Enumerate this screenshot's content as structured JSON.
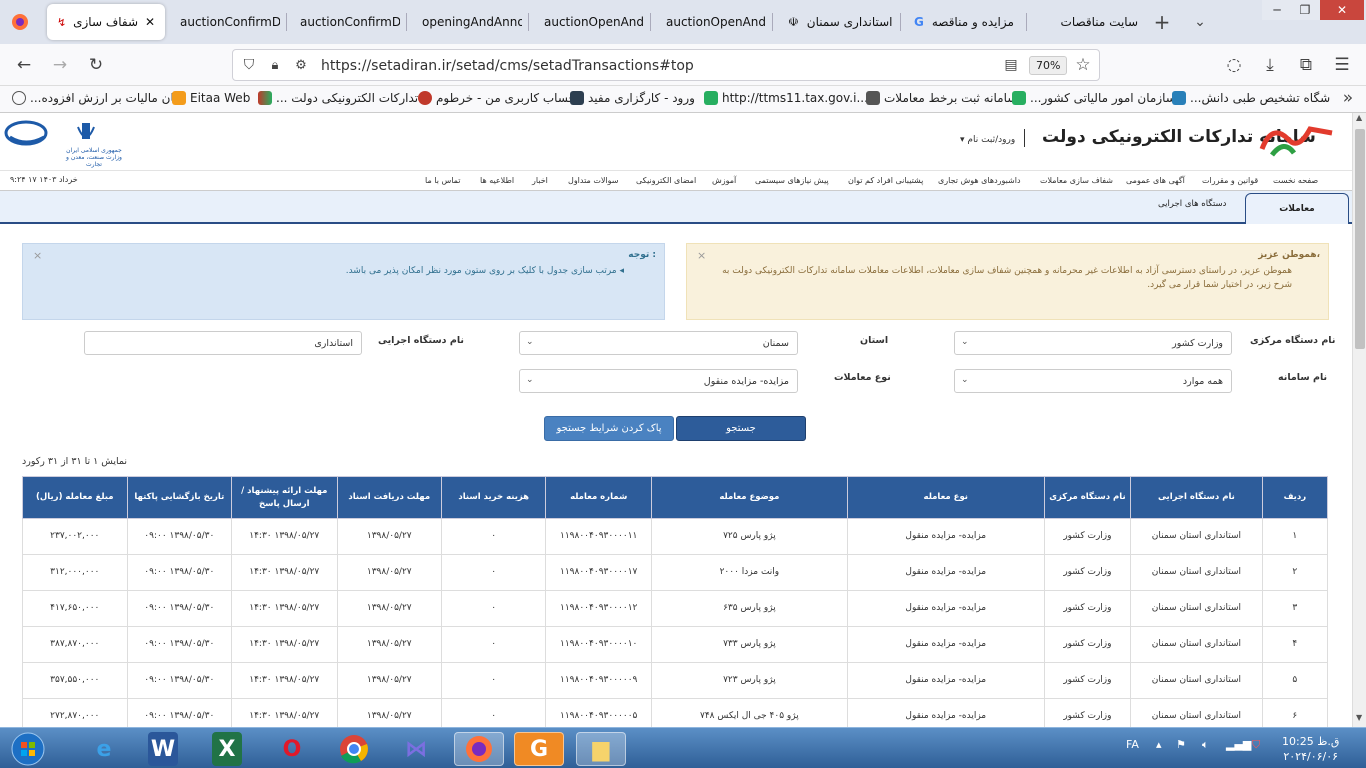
{
  "browser": {
    "tabs": [
      {
        "label": "شفاف سازی",
        "active": true
      },
      {
        "label": "auctionConfirmDis"
      },
      {
        "label": "auctionConfirmDis"
      },
      {
        "label": "openingAndAnnou"
      },
      {
        "label": "auctionOpenAndC"
      },
      {
        "label": "auctionOpenAndC"
      },
      {
        "label": "استانداری سمنان"
      },
      {
        "label": "مزایده و مناقصه"
      },
      {
        "label": "سایت مناقصات"
      }
    ],
    "url": "https://setadiran.ir/setad/cms/setadTransactions#top",
    "zoom": "70%",
    "bookmarks": [
      "...پان مالیات بر ارزش افزوده",
      "Eitaa Web",
      "... تدارکات الکترونیکی دولت",
      "حساب کاربری من - خرطوم",
      "ورود - کارگزاری مفید",
      "http://ttms11.tax.gov.i...",
      "سامانه ثبت برخط معاملات",
      "...سازمان امور مالیاتی کشور",
      "...شگاه تشخیص طبی دانش"
    ]
  },
  "site": {
    "title": "سامانه تدارکات الکترونیکی دولت",
    "login": "ورود/ثبت نام",
    "ministry": "جمهوری اسلامی ایران\nوزارت صنعت، معدن و تجارت",
    "datetime": "۹:۲۴ ۱۷ خرداد ۱۴۰۳",
    "menu": [
      "صفحه نخست",
      "قوانین و مقررات",
      "آگهی های عمومی",
      "شفاف سازی معاملات",
      "داشبوردهای هوش تجاری",
      "پشتیبانی افراد کم توان",
      "پیش نیازهای سیستمی",
      "آموزش",
      "امضای الکترونیکی",
      "سوالات متداول",
      "اخبار",
      "اطلاعیه ها",
      "تماس با ما"
    ],
    "subtabs": {
      "active": "معاملات",
      "other": "دستگاه های اجرایی"
    },
    "notice_right": {
      "title": "هموطن عزیز،",
      "text": "هموطن عزیز، در راستای دسترسی آزاد به اطلاعات غیر محرمانه و همچنین شفاف سازی معاملات، اطلاعات معاملات سامانه تدارکات الکترونیکی دولت به شرح زیر، در اختیار شما قرار می گیرد."
    },
    "notice_left": {
      "title": "توجه :",
      "text": "مرتب سازی جدول با کلیک بر روی ستون مورد نظر امکان پذیر می باشد."
    },
    "filters": {
      "central_label": "نام دستگاه مرکزی",
      "central_value": "وزارت کشور",
      "province_label": "استان",
      "province_value": "سمنان",
      "exec_label": "نام دستگاه اجرایی",
      "exec_value": "استانداری",
      "system_label": "نام سامانه",
      "system_value": "همه موارد",
      "type_label": "نوع معاملات",
      "type_value": "مزایده- مزایده منقول"
    },
    "buttons": {
      "search": "جستجو",
      "clear": "پاک کردن شرایط جستجو"
    },
    "records": "نمایش ۱ تا ۳۱ از ۳۱ رکورد",
    "table": {
      "headers": [
        "ردیف",
        "نام دستگاه اجرایی",
        "نام دستگاه مرکزی",
        "نوع معامله",
        "موضوع معامله",
        "شماره معامله",
        "هزینه خرید اسناد",
        "مهلت دریافت اسناد",
        "مهلت ارائه پیشنهاد / ارسال پاسخ",
        "تاریخ بازگشایی پاکتها",
        "مبلغ معامله (ریال)"
      ],
      "rows": [
        [
          "۱",
          "استانداری استان سمنان",
          "وزارت کشور",
          "مزایده- مزایده منقول",
          "پژو پارس ۷۲۵",
          "۱۱۹۸۰۰۴۰۹۳۰۰۰۰۱۱",
          "۰",
          "۱۳۹۸/۰۵/۲۷",
          "۱۳۹۸/۰۵/۲۷ ۱۴:۳۰",
          "۱۳۹۸/۰۵/۳۰ ۰۹:۰۰",
          "۲۳۷,۰۰۲,۰۰۰"
        ],
        [
          "۲",
          "استانداری استان سمنان",
          "وزارت کشور",
          "مزایده- مزایده منقول",
          "وانت مزدا ۲۰۰۰",
          "۱۱۹۸۰۰۴۰۹۳۰۰۰۰۱۷",
          "۰",
          "۱۳۹۸/۰۵/۲۷",
          "۱۳۹۸/۰۵/۲۷ ۱۴:۳۰",
          "۱۳۹۸/۰۵/۳۰ ۰۹:۰۰",
          "۳۱۲,۰۰۰,۰۰۰"
        ],
        [
          "۳",
          "استانداری استان سمنان",
          "وزارت کشور",
          "مزایده- مزایده منقول",
          "پژو پارس ۶۳۵",
          "۱۱۹۸۰۰۴۰۹۳۰۰۰۰۱۲",
          "۰",
          "۱۳۹۸/۰۵/۲۷",
          "۱۳۹۸/۰۵/۲۷ ۱۴:۳۰",
          "۱۳۹۸/۰۵/۳۰ ۰۹:۰۰",
          "۴۱۷,۶۵۰,۰۰۰"
        ],
        [
          "۴",
          "استانداری استان سمنان",
          "وزارت کشور",
          "مزایده- مزایده منقول",
          "پژو پارس ۷۳۳",
          "۱۱۹۸۰۰۴۰۹۳۰۰۰۰۱۰",
          "۰",
          "۱۳۹۸/۰۵/۲۷",
          "۱۳۹۸/۰۵/۲۷ ۱۴:۳۰",
          "۱۳۹۸/۰۵/۳۰ ۰۹:۰۰",
          "۳۸۷,۸۷۰,۰۰۰"
        ],
        [
          "۵",
          "استانداری استان سمنان",
          "وزارت کشور",
          "مزایده- مزایده منقول",
          "پژو پارس ۷۲۳",
          "۱۱۹۸۰۰۴۰۹۳۰۰۰۰۰۹",
          "۰",
          "۱۳۹۸/۰۵/۲۷",
          "۱۳۹۸/۰۵/۲۷ ۱۴:۳۰",
          "۱۳۹۸/۰۵/۳۰ ۰۹:۰۰",
          "۳۵۷,۵۵۰,۰۰۰"
        ],
        [
          "۶",
          "استانداری استان سمنان",
          "وزارت کشور",
          "مزایده- مزایده منقول",
          "پژو ۴۰۵ جی ال ایکس ۷۴۸",
          "۱۱۹۸۰۰۴۰۹۳۰۰۰۰۰۵",
          "۰",
          "۱۳۹۸/۰۵/۲۷",
          "۱۳۹۸/۰۵/۲۷ ۱۴:۳۰",
          "۱۳۹۸/۰۵/۳۰ ۰۹:۰۰",
          "۲۷۲,۸۷۰,۰۰۰"
        ]
      ]
    }
  },
  "taskbar": {
    "lang": "FA",
    "time": "10:25 ق.ظ",
    "date": "۲۰۲۴/۰۶/۰۶"
  }
}
